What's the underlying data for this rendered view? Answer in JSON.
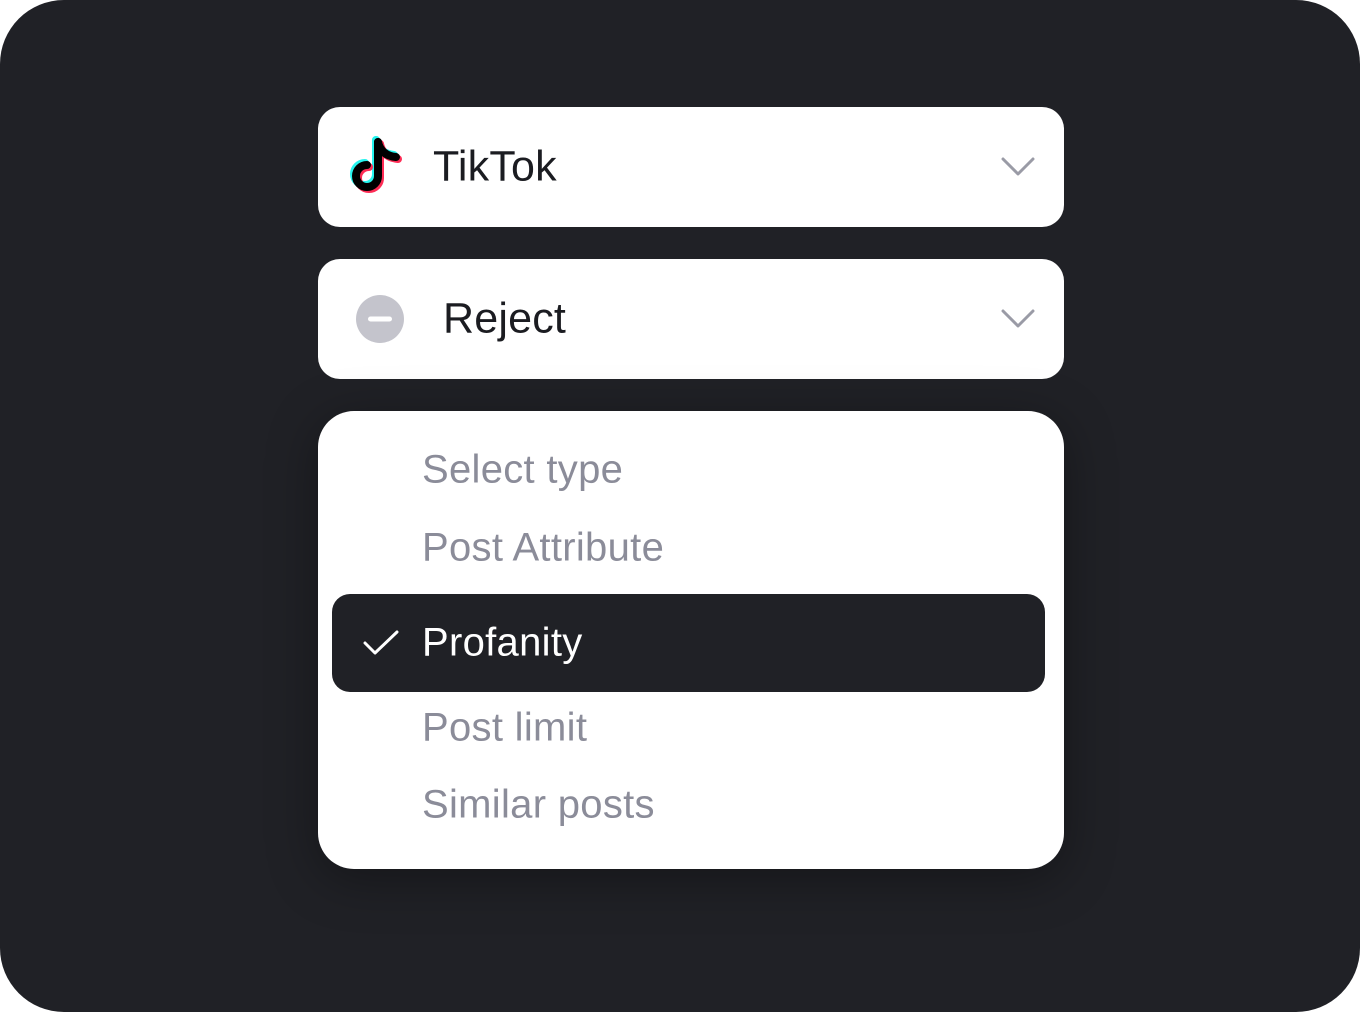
{
  "platform_select": {
    "value": "TikTok",
    "icon": "tiktok-logo",
    "colors": {
      "cyan": "#25F4EE",
      "red": "#FE2C55",
      "black": "#000000"
    }
  },
  "action_select": {
    "value": "Reject",
    "icon": "minus-circle-icon",
    "icon_color": "#c4c4cc"
  },
  "type_menu": {
    "items": [
      {
        "label": "Select type",
        "selected": false
      },
      {
        "label": "Post Attribute",
        "selected": false
      },
      {
        "label": "Profanity",
        "selected": true
      },
      {
        "label": "Post limit",
        "selected": false
      },
      {
        "label": "Similar posts",
        "selected": false
      }
    ]
  },
  "colors": {
    "background": "#202126",
    "surface": "#ffffff",
    "text_primary": "#1b1c21",
    "text_muted": "#8b8c99",
    "selected_bg": "#202126"
  }
}
